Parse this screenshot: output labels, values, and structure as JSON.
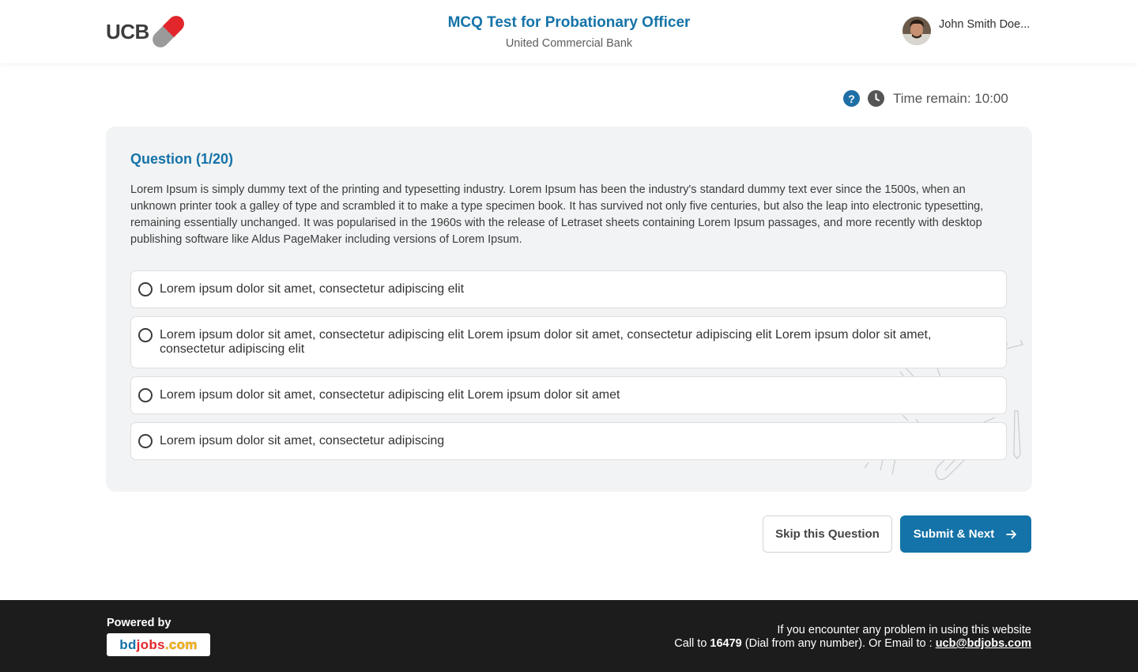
{
  "header": {
    "logo_text": "UCB",
    "title": "MCQ Test for Probationary Officer",
    "subtitle": "United Commercial Bank",
    "user_name": "John Smith Doe..."
  },
  "timer": {
    "label": "Time remain: 10:00",
    "help_symbol": "?"
  },
  "question": {
    "title": "Question (1/20)",
    "text": "Lorem Ipsum is simply dummy text of the printing and typesetting industry. Lorem Ipsum has been the industry's standard dummy text ever since the 1500s, when an unknown printer took a galley of type and scrambled it to make a type specimen book. It has survived not only five centuries, but also the leap into electronic typesetting, remaining essentially unchanged. It was popularised in the 1960s with the release of Letraset sheets containing Lorem Ipsum passages, and more recently with desktop publishing software like Aldus PageMaker including versions of Lorem Ipsum.",
    "options": [
      {
        "label": "Lorem ipsum dolor sit amet, consectetur adipiscing elit",
        "selected": false
      },
      {
        "label": "Lorem ipsum dolor sit amet, consectetur adipiscing elit Lorem ipsum dolor sit amet, consectetur adipiscing elit Lorem ipsum dolor sit amet, consectetur adipiscing elit",
        "selected": false
      },
      {
        "label": "Lorem ipsum dolor sit amet, consectetur adipiscing elit Lorem ipsum dolor sit amet",
        "selected": false
      },
      {
        "label": "Lorem ipsum dolor sit amet, consectetur adipiscing",
        "selected": false
      }
    ]
  },
  "actions": {
    "skip_label": "Skip this Question",
    "submit_label": "Submit & Next"
  },
  "footer": {
    "powered_by": "Powered by",
    "brand_part1": "bd",
    "brand_part2": "jobs",
    "brand_part3": ".com",
    "contact_line1": "If you encounter any problem in using this website",
    "call_prefix": "Call to ",
    "phone": "16479",
    "call_suffix": " (Dial from any number). Or Email to : ",
    "email": "ucb@bdjobs.com"
  },
  "colors": {
    "accent": "#1473a8",
    "card_bg": "#f2f3f4",
    "footer_bg": "#1c1c1c",
    "logo_red": "#e2262b"
  }
}
